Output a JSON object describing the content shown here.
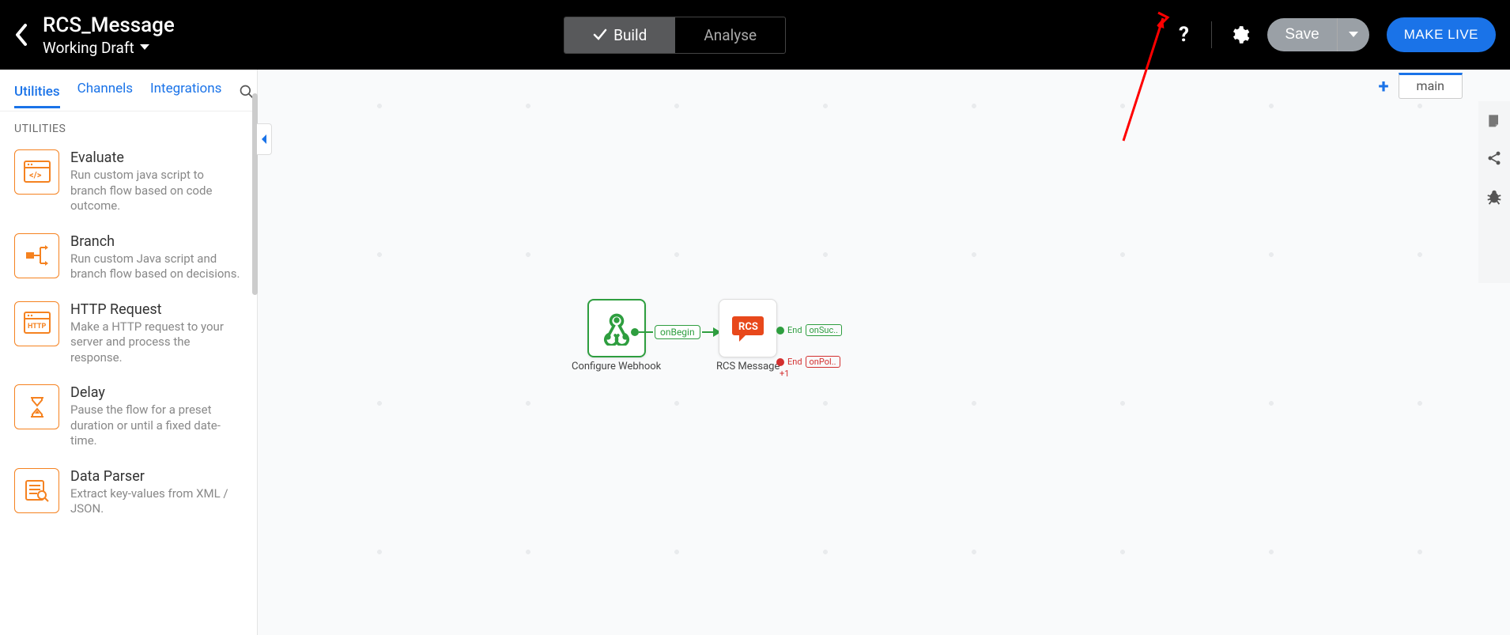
{
  "header": {
    "title": "RCS_Message",
    "subtitle": "Working Draft",
    "build_label": "Build",
    "analyse_label": "Analyse",
    "save_label": "Save",
    "make_live_label": "MAKE LIVE"
  },
  "sidebar": {
    "tabs": {
      "utilities": "Utilities",
      "channels": "Channels",
      "integrations": "Integrations"
    },
    "section_label": "UTILITIES",
    "items": [
      {
        "title": "Evaluate",
        "desc": "Run custom java script to branch flow based on code outcome."
      },
      {
        "title": "Branch",
        "desc": "Run custom Java script and branch flow based on decisions."
      },
      {
        "title": "HTTP Request",
        "desc": "Make a HTTP request to your server and process the response."
      },
      {
        "title": "Delay",
        "desc": "Pause the flow for a preset duration or until a fixed date-time."
      },
      {
        "title": "Data Parser",
        "desc": "Extract key-values from XML / JSON."
      }
    ]
  },
  "canvas": {
    "flow_tab": "main",
    "node_start_label": "Configure Webhook",
    "node_rcs_label": "RCS Message",
    "connector_label": "onBegin",
    "out_green": {
      "end": "End",
      "label": "onSuc.."
    },
    "out_red": {
      "end": "End",
      "label": "onPol..",
      "plus": "+1"
    }
  },
  "icons": {
    "http": "HTTP"
  }
}
